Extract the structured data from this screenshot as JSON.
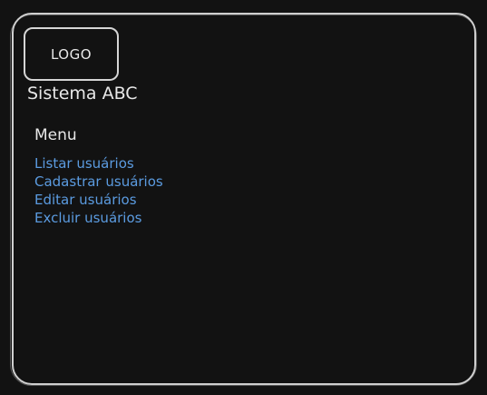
{
  "logo": {
    "label": "LOGO"
  },
  "app": {
    "title": "Sistema ABC"
  },
  "menu": {
    "title": "Menu",
    "items": [
      {
        "label": "Listar usuários"
      },
      {
        "label": "Cadastrar usuários"
      },
      {
        "label": "Editar usuários"
      },
      {
        "label": "Excluir usuários"
      }
    ]
  },
  "colors": {
    "background": "#121212",
    "border": "#cfcfcf",
    "text": "#e8e8e8",
    "link": "#5b9be0"
  }
}
